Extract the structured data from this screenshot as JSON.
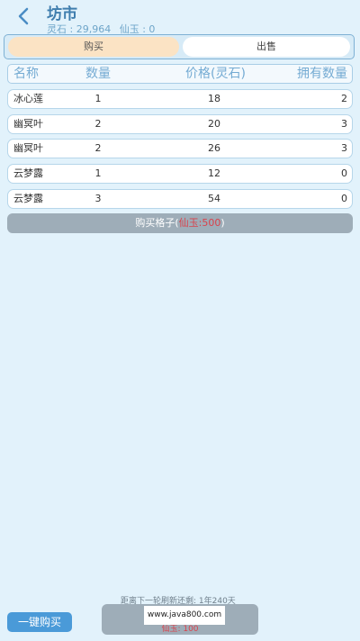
{
  "header": {
    "title": "坊市",
    "currency": {
      "lingshi": "灵石 : 29,964",
      "xianyu": "仙玉 : 0"
    }
  },
  "tabs": {
    "buy": "购买",
    "sell": "出售"
  },
  "table": {
    "columns": {
      "name": "名称",
      "qty": "数量",
      "price": "价格(灵石)",
      "owned": "拥有数量"
    },
    "rows": [
      {
        "name": "冰心莲",
        "qty": "1",
        "price": "18",
        "owned": "2"
      },
      {
        "name": "幽冥叶",
        "qty": "2",
        "price": "20",
        "owned": "3"
      },
      {
        "name": "幽冥叶",
        "qty": "2",
        "price": "26",
        "owned": "3"
      },
      {
        "name": "云梦露",
        "qty": "1",
        "price": "12",
        "owned": "0"
      },
      {
        "name": "云梦露",
        "qty": "3",
        "price": "54",
        "owned": "0"
      }
    ]
  },
  "buy_slot": {
    "label": "购买格子(",
    "price": "仙玉:500",
    "suffix": ")"
  },
  "footer": {
    "countdown": "距离下一轮刷新还剩: 1年240天",
    "onekey_buy": "一键购买",
    "refresh_cost": "仙玉: 100",
    "watermark": "www.java800.com"
  },
  "colors": {
    "background": "#e2f2fb",
    "title": "#3f7eae",
    "active_tab": "#fbe3c4",
    "button_gray": "#9eadb8",
    "button_blue": "#4a9ad8",
    "price_red": "#d9424c"
  },
  "icons": {
    "back": "chevron-left-icon"
  }
}
